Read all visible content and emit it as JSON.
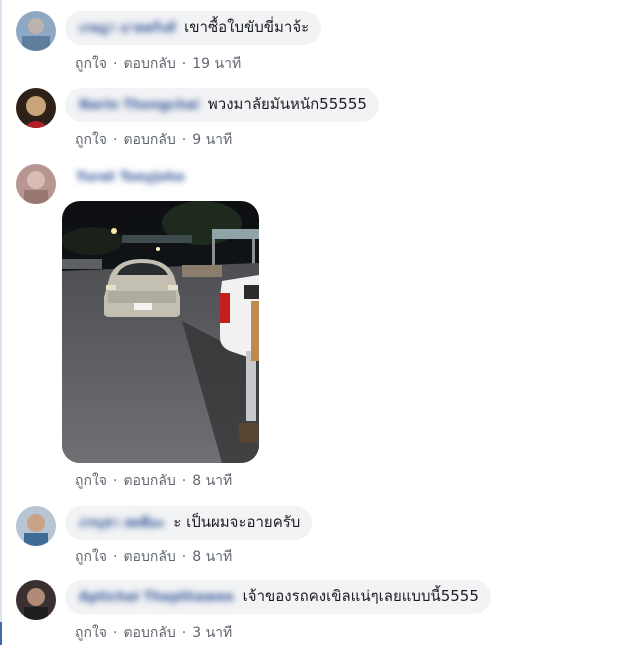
{
  "comments": [
    {
      "name": "เกษฎา มาดตกิงส์",
      "text": "เขาซื้อใบขับขี่มาจ้ะ",
      "like": "ถูกใจ",
      "reply": "ตอบกลับ",
      "time": "19 นาที",
      "avatar_color": "#7a97b8"
    },
    {
      "name": "Narin Thongchai",
      "text": "พวงมาลัยมันหนัก55555",
      "like": "ถูกใจ",
      "reply": "ตอบกลับ",
      "time": "9 นาที",
      "avatar_color": "#4b3425"
    },
    {
      "name": "Yurat Toeyjoho",
      "image_description_icon": "photo",
      "like": "ถูกใจ",
      "reply": "ตอบกลับ",
      "time": "8 นาที",
      "avatar_color": "#b99893"
    },
    {
      "name": "ภรนุชา สตตีมะ",
      "text": "ะ เป็นผมจะอายครับ",
      "like": "ถูกใจ",
      "reply": "ตอบกลับ",
      "time": "8 นาที",
      "avatar_color": "#9fb1c4"
    },
    {
      "name": "Aptichai Thepthawee",
      "text": "เจ้าของรถคงเขิลแน่ๆเลยแบบนี้5555",
      "like": "ถูกใจ",
      "reply": "ตอบกลับ",
      "time": "3 นาที",
      "avatar_color": "#5a4a45"
    }
  ],
  "separator": "·",
  "colors": {
    "link_name": "#385898",
    "bubble_bg": "#f2f3f5",
    "meta_text": "#606770"
  }
}
